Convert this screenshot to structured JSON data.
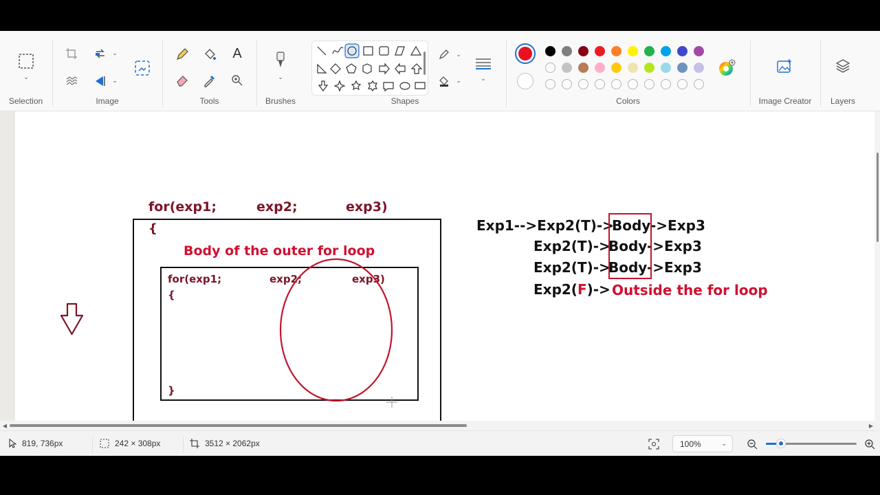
{
  "ribbon": {
    "groups": {
      "selection": "Selection",
      "image": "Image",
      "tools": "Tools",
      "brushes": "Brushes",
      "shapes": "Shapes",
      "colors": "Colors",
      "image_creator": "Image Creator",
      "layers": "Layers"
    },
    "colors": {
      "primary": "#e81123",
      "secondary": "#ffffff",
      "palette_row1": [
        "#000000",
        "#7f7f7f",
        "#880015",
        "#ed1c24",
        "#ff7f27",
        "#fff200",
        "#22b14c",
        "#00a2e8",
        "#3f48cc",
        "#a349a4"
      ],
      "palette_row2": [
        "#ffffff",
        "#c3c3c3",
        "#b97a57",
        "#ffaec9",
        "#ffc90e",
        "#efe4b0",
        "#b5e61d",
        "#99d9ea",
        "#7092be",
        "#c8bfe7"
      ]
    }
  },
  "canvas": {
    "outer_header": [
      "for(exp1;",
      "exp2;",
      "exp3)"
    ],
    "outer_open_brace": "{",
    "outer_body_label": "Body of  the outer for loop",
    "inner_header": [
      "for(exp1;",
      "exp2;",
      "exp3)"
    ],
    "inner_open_brace": "{",
    "inner_close_brace": "}",
    "outer_close_brace": "}",
    "flow": {
      "line1": [
        "Exp1-->Exp2(T)->",
        "Body",
        "->Exp3"
      ],
      "line2": [
        "Exp2(T)->",
        "Body",
        "->Exp3"
      ],
      "line3": [
        "Exp2(T)->",
        "Body",
        "->Exp3"
      ],
      "line4_prefix": "Exp2(",
      "line4_flag": "F",
      "line4_suffix": ")->",
      "line4_result": "Outside the for loop"
    }
  },
  "status": {
    "cursor_pos": "819, 736px",
    "selection_size": "242 × 308px",
    "canvas_size": "3512 × 2062px",
    "zoom": "100%",
    "zoom_fraction": 0.17
  }
}
